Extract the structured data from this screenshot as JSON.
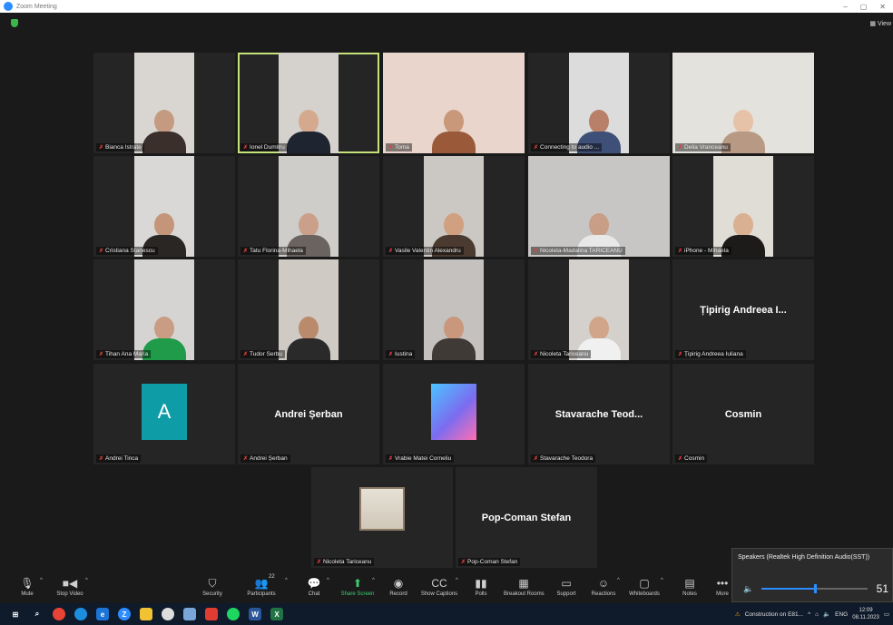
{
  "window": {
    "title": "Zoom Meeting",
    "view_label": "View",
    "minimize": "–",
    "maximize": "▢",
    "close": "✕"
  },
  "tiles": [
    {
      "name": "Bianca Istrate",
      "type": "video",
      "bg": "#d9d6d1",
      "skin": "#c49a80",
      "shirt": "#3a2f2a"
    },
    {
      "name": "Ionel Dumitru",
      "type": "video",
      "bg": "#d5d2ce",
      "skin": "#d4a98e",
      "shirt": "#1e2430",
      "active": true
    },
    {
      "name": "Toma",
      "type": "video",
      "bg": "#e9d5cc",
      "skin": "#c9987a",
      "shirt": "#9a5a3a"
    },
    {
      "name": "Connecting to audio ...",
      "type": "video",
      "bg": "#dcdcdc",
      "skin": "#b88068",
      "shirt": "#3e4f78"
    },
    {
      "name": "Delia Vranceanu",
      "type": "video",
      "bg": "#e4e2dd",
      "skin": "#e6c2a8",
      "shirt": "#b89a84"
    },
    {
      "name": "Cristiana Stanescu",
      "type": "video",
      "bg": "#d9d8d6",
      "skin": "#c49578",
      "shirt": "#2a2624"
    },
    {
      "name": "Tatu Florina-Mihaela",
      "type": "video",
      "bg": "#cfcdc9",
      "skin": "#caa08a",
      "shirt": "#6a6360"
    },
    {
      "name": "Vasile Valentin Alexandru",
      "type": "video",
      "bg": "#cbc7c2",
      "skin": "#d0a080",
      "shirt": "#4a3a30"
    },
    {
      "name": "Nicoleta-Madalina TARICEANU",
      "type": "video",
      "bg": "#c8c6c4",
      "skin": "#c99e87",
      "shirt": "#e8e8e8"
    },
    {
      "name": "iPhone - Mihaela",
      "type": "video",
      "bg": "#e0dcd6",
      "skin": "#d9b092",
      "shirt": "#1d1a1a"
    },
    {
      "name": "Tihan Ana Maria",
      "type": "video",
      "bg": "#d6d4d2",
      "skin": "#c99c84",
      "shirt": "#1f9b49"
    },
    {
      "name": "Tudor Serbu",
      "type": "video",
      "bg": "#cfcac4",
      "skin": "#b98a6c",
      "shirt": "#2a2a2a"
    },
    {
      "name": "Iustina",
      "type": "video",
      "bg": "#c4c1be",
      "skin": "#c8977c",
      "shirt": "#403a36"
    },
    {
      "name": "Nicoleta Tariceanu",
      "type": "video",
      "bg": "#d4d0cb",
      "skin": "#d1a58a",
      "shirt": "#f0f0f0"
    },
    {
      "name": "Țipirig Andreea Iuliana",
      "type": "name",
      "display": "Țipirig Andreea I..."
    },
    {
      "name": "Andrei Tinca",
      "type": "avatar",
      "letter": "A",
      "color": "#0e9da7"
    },
    {
      "name": "Andrei Șerban",
      "type": "name",
      "display": "Andrei Șerban"
    },
    {
      "name": "Vrabie Matei Corneliu",
      "type": "gradient"
    },
    {
      "name": "Stavarache Teodora",
      "type": "name",
      "display": "Stavarache Teod..."
    },
    {
      "name": "Cosmin",
      "type": "name",
      "display": "Cosmin"
    },
    {
      "name": "Nicoleta Tariceanu",
      "type": "picture"
    },
    {
      "name": "Pop-Coman Stefan",
      "type": "name",
      "display": "Pop-Coman Stefan"
    }
  ],
  "toolbar": {
    "mute": "Mute",
    "stop_video": "Stop Video",
    "security": "Security",
    "participants": "Participants",
    "participants_count": "22",
    "chat": "Chat",
    "share_screen": "Share Screen",
    "record": "Record",
    "show_captions": "Show Captions",
    "polls": "Polls",
    "breakout_rooms": "Breakout Rooms",
    "support": "Support",
    "reactions": "Reactions",
    "whiteboards": "Whiteboards",
    "notes": "Notes",
    "more": "More"
  },
  "speakers": {
    "header": "Speakers (Realtek High Definition Audio(SST))",
    "volume": "51",
    "volume_value": 51
  },
  "taskbar": {
    "notification": "Construction on E81...",
    "language": "ENG",
    "time": "12:09",
    "date": "08.11.2023"
  },
  "colors": {
    "active_speaker": "#c6e37a",
    "share_green": "#3bd16f",
    "mic_off_red": "#e5403a",
    "accent": "#2d8cff"
  }
}
